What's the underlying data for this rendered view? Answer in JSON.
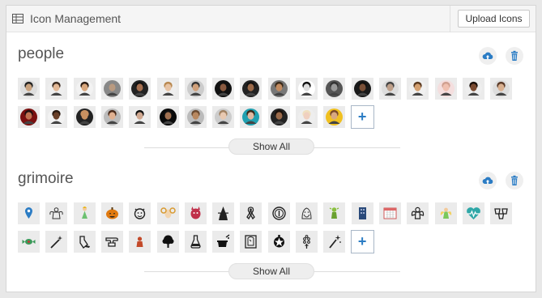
{
  "header": {
    "title": "Icon Management",
    "upload_label": "Upload Icons"
  },
  "sections": [
    {
      "name": "people",
      "show_all_label": "Show All",
      "add_label": "+",
      "icons": [
        {
          "name": "man-suit",
          "skin": "#c9a27e",
          "hair": "#222",
          "bg": "#ddd"
        },
        {
          "name": "woman-dark-hair",
          "skin": "#e2b896",
          "hair": "#3a2a20",
          "bg": "#eee"
        },
        {
          "name": "man-hat",
          "skin": "#d8a67c",
          "hair": "#2a1c14",
          "bg": "#f2f2f2"
        },
        {
          "name": "old-man",
          "skin": "#b99a80",
          "hair": "#888",
          "bg": "#888"
        },
        {
          "name": "man-dark",
          "skin": "#a67050",
          "hair": "#111",
          "bg": "#222"
        },
        {
          "name": "woman-blonde",
          "skin": "#e7c3a4",
          "hair": "#b88850",
          "bg": "#eee"
        },
        {
          "name": "man-smile",
          "skin": "#d0a07a",
          "hair": "#333",
          "bg": "#ccc"
        },
        {
          "name": "woman-black",
          "skin": "#8a5a40",
          "hair": "#111",
          "bg": "#111"
        },
        {
          "name": "man-beard",
          "skin": "#9b6a4a",
          "hair": "#111",
          "bg": "#222"
        },
        {
          "name": "man-brown",
          "skin": "#c28b60",
          "hair": "#3a2a1a",
          "bg": "#777"
        },
        {
          "name": "man-bw",
          "skin": "#ddd",
          "hair": "#111",
          "bg": "#fff"
        },
        {
          "name": "man-gray",
          "skin": "#999",
          "hair": "#333",
          "bg": "#555"
        },
        {
          "name": "man-dark-bg",
          "skin": "#7a5038",
          "hair": "#111",
          "bg": "#1a1a1a"
        },
        {
          "name": "man-glasses",
          "skin": "#bfa08a",
          "hair": "#444",
          "bg": "#ddd"
        },
        {
          "name": "man-tan",
          "skin": "#d4a070",
          "hair": "#5a3a20",
          "bg": "#f0f0f0"
        },
        {
          "name": "woman-pink",
          "skin": "#f0c0b0",
          "hair": "#d0a090",
          "bg": "#f4dede"
        },
        {
          "name": "woman-curly",
          "skin": "#7a4a30",
          "hair": "#1a100a",
          "bg": "#eee"
        },
        {
          "name": "woman-brown",
          "skin": "#d9b090",
          "hair": "#5a3a28",
          "bg": "#ddd"
        },
        {
          "name": "woman-red",
          "skin": "#c07050",
          "hair": "#201010",
          "bg": "#7a1010"
        },
        {
          "name": "woman-afro",
          "skin": "#6a4028",
          "hair": "#2a1a10",
          "bg": "#f2f2f2"
        },
        {
          "name": "man-bald",
          "skin": "#c89060",
          "hair": "#c89060",
          "bg": "#222"
        },
        {
          "name": "woman-smile",
          "skin": "#e0b090",
          "hair": "#4a2a1a",
          "bg": "#bbb"
        },
        {
          "name": "man-cap",
          "skin": "#d0a890",
          "hair": "#111",
          "bg": "#eee"
        },
        {
          "name": "woman-dark",
          "skin": "#a07050",
          "hair": "#111",
          "bg": "#0a0a0a"
        },
        {
          "name": "man-tanned",
          "skin": "#b88860",
          "hair": "#6a4a30",
          "bg": "#bbb"
        },
        {
          "name": "woman-light",
          "skin": "#e8c8b0",
          "hair": "#a08060",
          "bg": "#ccc"
        },
        {
          "name": "woman-teal",
          "skin": "#e0b8a0",
          "hair": "#3a2a1a",
          "bg": "#20a0b0"
        },
        {
          "name": "woman-long",
          "skin": "#9a6a4a",
          "hair": "#1a100a",
          "bg": "#222"
        },
        {
          "name": "woman-platinum",
          "skin": "#f0d0c0",
          "hair": "#f0e0c0",
          "bg": "#eee"
        },
        {
          "name": "woman-yellow",
          "skin": "#d8a880",
          "hair": "#7a4a2a",
          "bg": "#f0c020"
        }
      ]
    },
    {
      "name": "grimoire",
      "show_all_label": "Show All",
      "add_label": "+",
      "icons": [
        {
          "name": "map-pin-icon"
        },
        {
          "name": "angel-outline-icon"
        },
        {
          "name": "fairy-icon"
        },
        {
          "name": "pumpkin-icon"
        },
        {
          "name": "devil-face-icon"
        },
        {
          "name": "ram-face-icon"
        },
        {
          "name": "demon-icon"
        },
        {
          "name": "witch-icon"
        },
        {
          "name": "ribbon-icon"
        },
        {
          "name": "coin-icon"
        },
        {
          "name": "wizard-face-icon"
        },
        {
          "name": "goblin-icon"
        },
        {
          "name": "tower-icon"
        },
        {
          "name": "calendar-icon"
        },
        {
          "name": "cherub-icon"
        },
        {
          "name": "angel-color-icon"
        },
        {
          "name": "heart-pulse-icon"
        },
        {
          "name": "cauldrons-icon"
        },
        {
          "name": "candy-icon"
        },
        {
          "name": "magic-wand-icon"
        },
        {
          "name": "potion-pour-icon"
        },
        {
          "name": "anvil-icon"
        },
        {
          "name": "stamp-icon"
        },
        {
          "name": "tree-icon"
        },
        {
          "name": "flask-icon"
        },
        {
          "name": "magic-hat-icon"
        },
        {
          "name": "mirror-icon"
        },
        {
          "name": "pentagram-icon"
        },
        {
          "name": "rosary-icon"
        },
        {
          "name": "sparkle-wand-icon"
        }
      ]
    }
  ],
  "colors": {
    "accent": "#2b7cc4",
    "tile_bg": "#ebebeb"
  }
}
